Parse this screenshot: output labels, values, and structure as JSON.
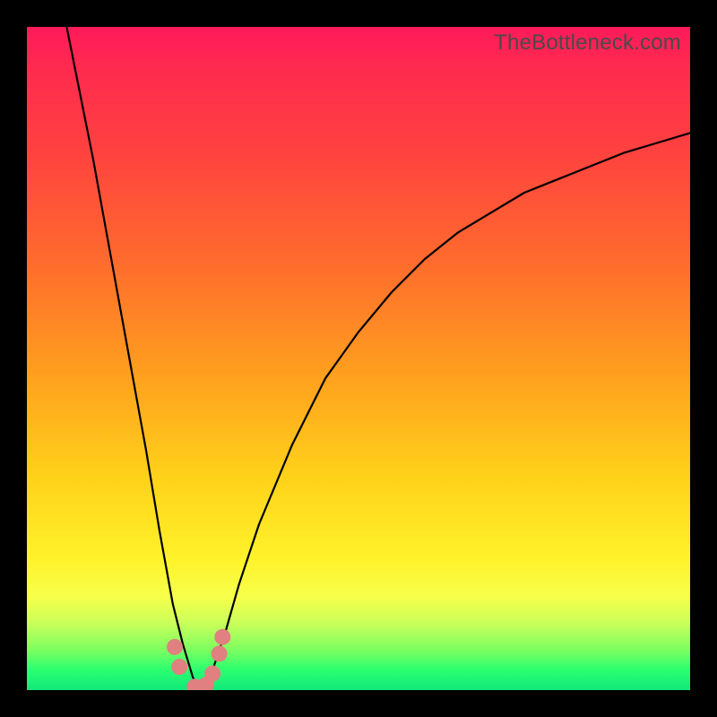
{
  "watermark": "TheBottleneck.com",
  "colors": {
    "frame": "#000000",
    "dot": "#e08080",
    "curve": "#000000"
  },
  "chart_data": {
    "type": "line",
    "title": "",
    "xlabel": "",
    "ylabel": "",
    "xlim": [
      0,
      100
    ],
    "ylim": [
      0,
      100
    ],
    "grid": false,
    "legend": false,
    "note": "V-shaped bottleneck curve with minimum near x≈26; y encodes bottleneck percentage (low=green=balanced, high=red=severe). Values estimated from pixels.",
    "series": [
      {
        "name": "left-branch",
        "x": [
          6,
          8,
          10,
          12,
          14,
          16,
          18,
          20,
          22,
          23.5,
          25,
          26
        ],
        "y": [
          100,
          90,
          80,
          69,
          58,
          47,
          36,
          24,
          13,
          7,
          2,
          0
        ]
      },
      {
        "name": "right-branch",
        "x": [
          26,
          28,
          30,
          32,
          35,
          40,
          45,
          50,
          55,
          60,
          65,
          70,
          75,
          80,
          85,
          90,
          95,
          100
        ],
        "y": [
          0,
          3,
          9,
          16,
          25,
          37,
          47,
          54,
          60,
          65,
          69,
          72,
          75,
          77,
          79,
          81,
          82.5,
          84
        ]
      }
    ],
    "markers": {
      "name": "optimal-zone-dots",
      "x": [
        22.3,
        23,
        25.3,
        27,
        28,
        29,
        29.5
      ],
      "y": [
        6.5,
        3.5,
        0.5,
        0.8,
        2.5,
        5.5,
        8
      ]
    },
    "background_gradient_stops": [
      {
        "pos": 0.0,
        "color": "#ff1a5a"
      },
      {
        "pos": 0.18,
        "color": "#ff4040"
      },
      {
        "pos": 0.52,
        "color": "#ff9e1e"
      },
      {
        "pos": 0.8,
        "color": "#fff22a"
      },
      {
        "pos": 0.94,
        "color": "#7aff60"
      },
      {
        "pos": 1.0,
        "color": "#10e87a"
      }
    ]
  }
}
